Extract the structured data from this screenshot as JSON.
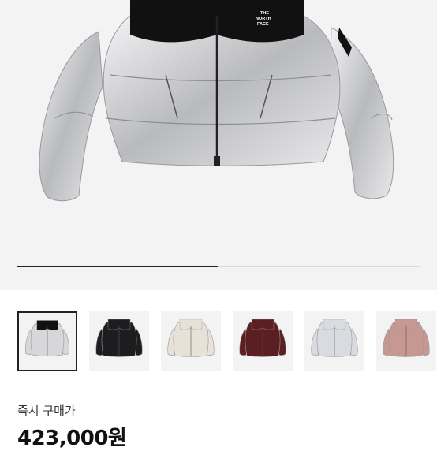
{
  "product": {
    "brand_logo_text": "THE NORTH FACE",
    "instant_buy_label": "즉시 구매가",
    "price": "423,000원"
  },
  "gallery": {
    "slides_total": 1,
    "progress_fraction": 0.5
  },
  "thumbnails": [
    {
      "name": "silver-thumbnail",
      "color": "#d7d7d9",
      "yoke": "#111111",
      "selected": true
    },
    {
      "name": "black-thumbnail",
      "color": "#1d1d1f",
      "yoke": "#1d1d1f",
      "selected": false
    },
    {
      "name": "cream-thumbnail",
      "color": "#e6e2d8",
      "yoke": "#e6e2d8",
      "selected": false
    },
    {
      "name": "burgundy-thumbnail",
      "color": "#5b1f22",
      "yoke": "#5b1f22",
      "selected": false
    },
    {
      "name": "light-silver-thumbnail",
      "color": "#d9dbe0",
      "yoke": "#d9dbe0",
      "selected": false
    },
    {
      "name": "rose-thumbnail",
      "color": "#c79892",
      "yoke": "#c79892",
      "selected": false
    }
  ],
  "colors": {
    "price_text": "#111111",
    "hero_background": "#f3f3f3"
  }
}
